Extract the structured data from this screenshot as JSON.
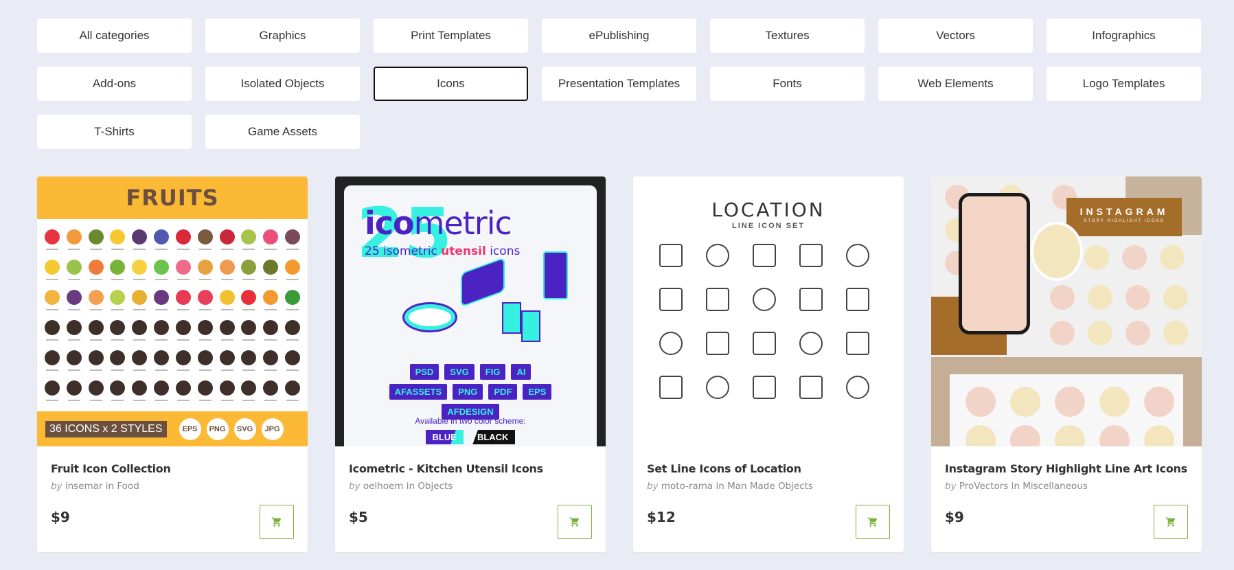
{
  "categories": [
    {
      "label": "All categories",
      "active": false
    },
    {
      "label": "Graphics",
      "active": false
    },
    {
      "label": "Print Templates",
      "active": false
    },
    {
      "label": "ePublishing",
      "active": false
    },
    {
      "label": "Textures",
      "active": false
    },
    {
      "label": "Vectors",
      "active": false
    },
    {
      "label": "Infographics",
      "active": false
    },
    {
      "label": "Add-ons",
      "active": false
    },
    {
      "label": "Isolated Objects",
      "active": false
    },
    {
      "label": "Icons",
      "active": true
    },
    {
      "label": "Presentation Templates",
      "active": false
    },
    {
      "label": "Fonts",
      "active": false
    },
    {
      "label": "Web Elements",
      "active": false
    },
    {
      "label": "Logo Templates",
      "active": false
    },
    {
      "label": "T-Shirts",
      "active": false
    },
    {
      "label": "Game Assets",
      "active": false
    }
  ],
  "products": [
    {
      "title": "Fruit Icon Collection",
      "by": "by",
      "author": "insemar",
      "in": "in",
      "category": "Food",
      "price": "$9",
      "thumb": {
        "heading": "FRUITS",
        "label": "36 ICONS x 2 STYLES",
        "formats": [
          "EPS",
          "PNG",
          "SVG",
          "JPG"
        ]
      }
    },
    {
      "title": "Icometric - Kitchen Utensil Icons",
      "by": "by",
      "author": "oelhoem",
      "in": "in",
      "category": "Objects",
      "price": "$5",
      "thumb": {
        "big": "25",
        "logo_bold": "ico",
        "logo_rest": "metric",
        "sub_a": "25 isometric",
        "sub_b": "utensil",
        "sub_c": "icons",
        "formats": [
          "PSD",
          "SVG",
          "FIG",
          "AI",
          "AFASSETS",
          "PNG",
          "PDF",
          "EPS",
          "AFDESIGN"
        ],
        "available": "Available in two color scheme:",
        "schemes": [
          "BLUE",
          "BLACK"
        ]
      }
    },
    {
      "title": "Set Line Icons of Location",
      "by": "by",
      "author": "moto-rama",
      "in": "in",
      "category": "Man Made Objects",
      "price": "$12",
      "thumb": {
        "heading": "LOCATION",
        "sub": "LINE ICON SET"
      }
    },
    {
      "title": "Instagram Story Highlight Line Art Icons",
      "by": "by",
      "author": "ProVectors",
      "in": "in",
      "category": "Miscellaneous",
      "price": "$9",
      "thumb": {
        "heading": "INSTAGRAM",
        "sub": "STORY HIGHLIGHT ICONS"
      }
    }
  ],
  "icons": {
    "cart": "shopping-cart-icon"
  },
  "colors": {
    "background": "#e9ecf4",
    "cart_accent": "#7bb13c",
    "active_border": "#111111"
  }
}
